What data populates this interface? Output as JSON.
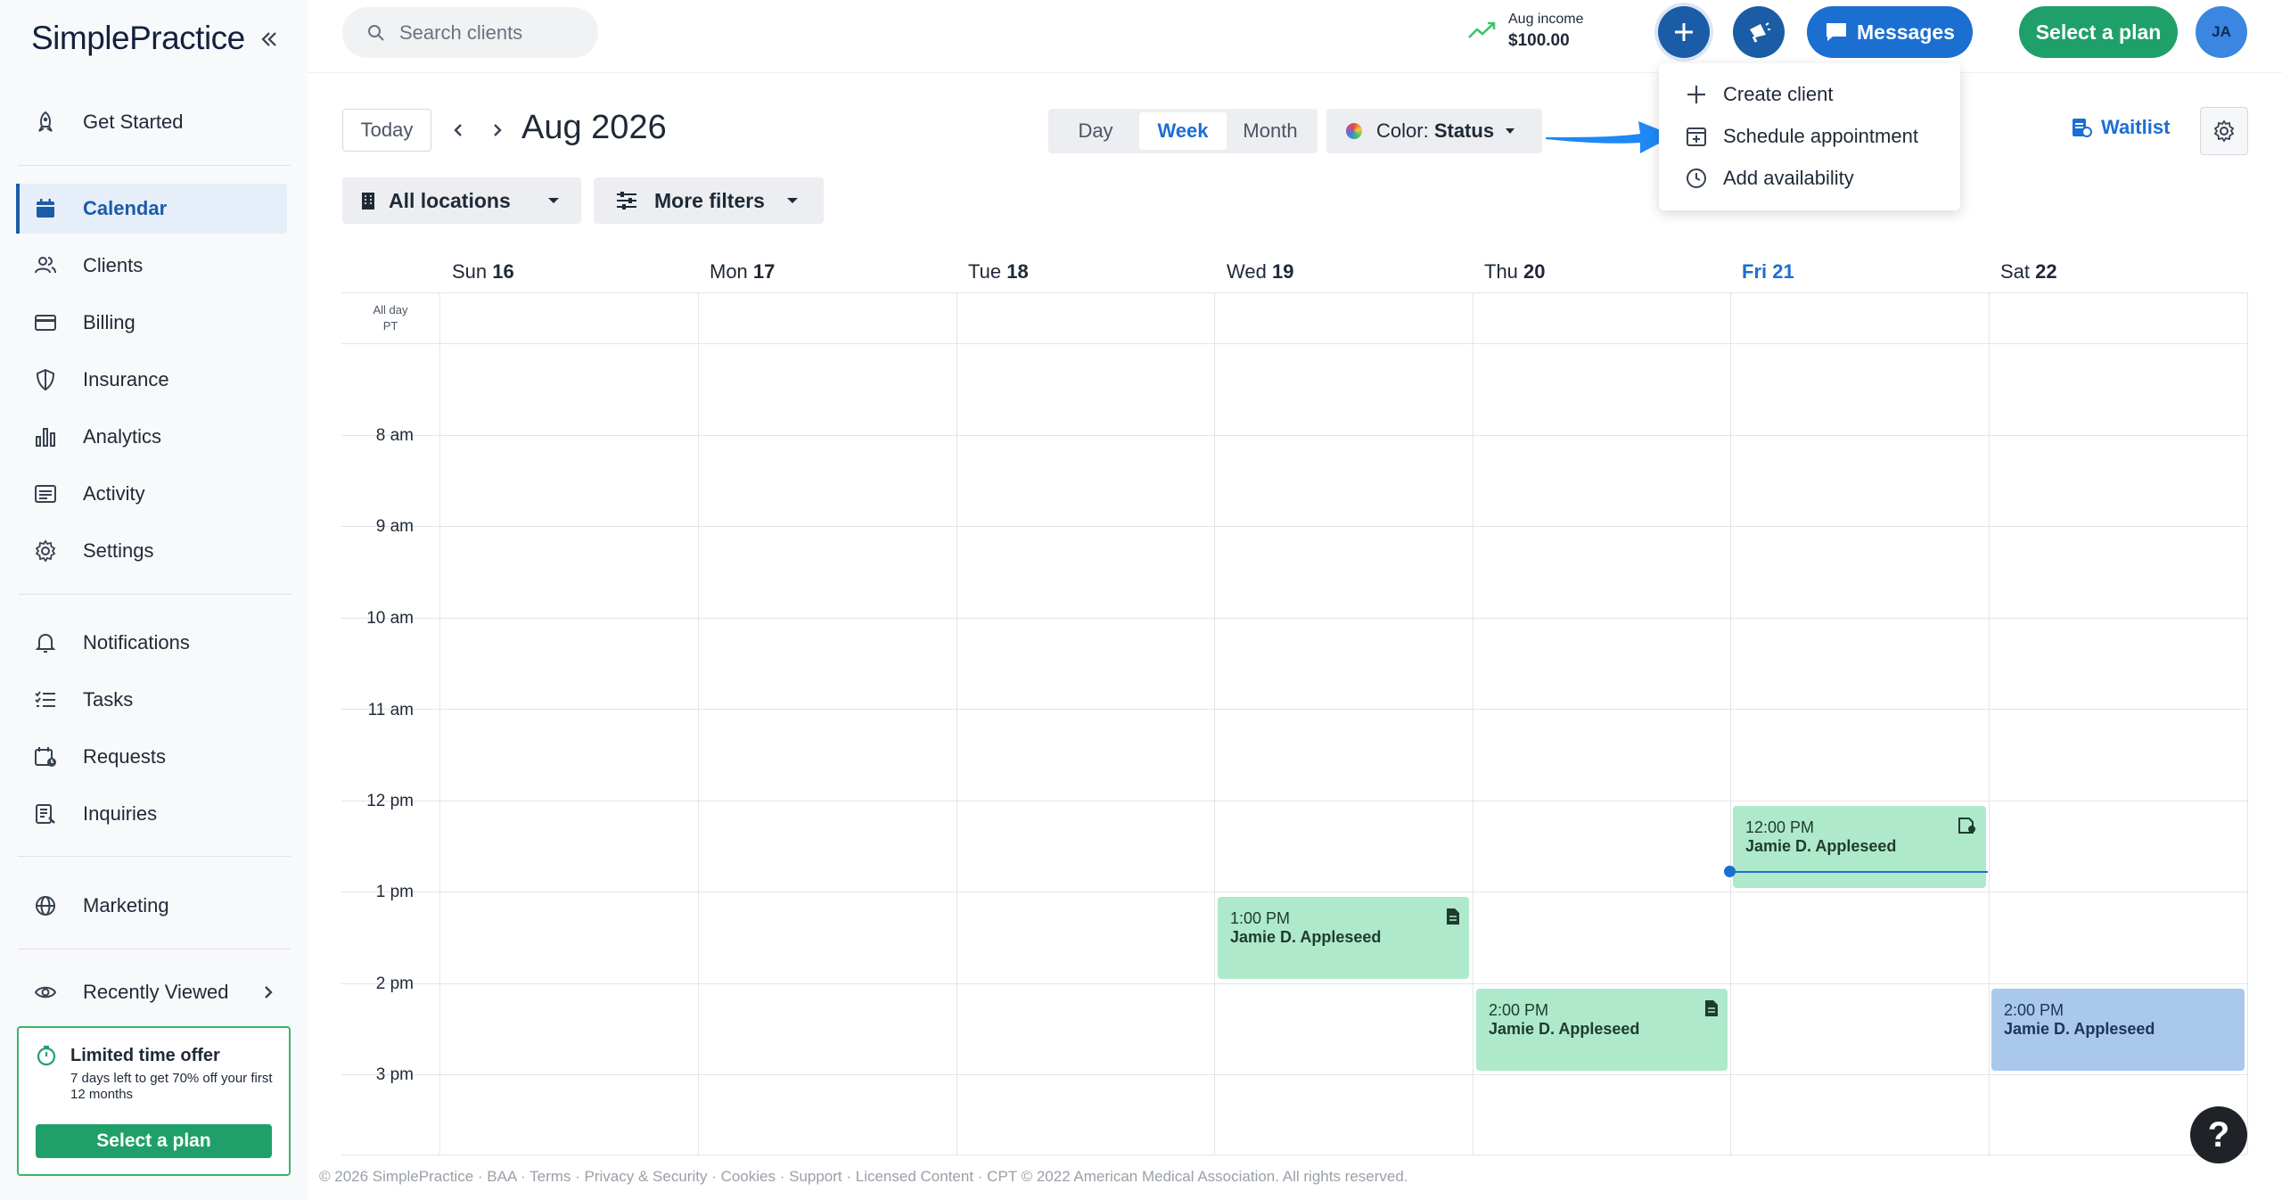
{
  "app": {
    "logo": "SimplePractice"
  },
  "sidebar": {
    "items": [
      {
        "label": "Get Started",
        "icon": "rocket-icon"
      },
      {
        "label": "Calendar",
        "icon": "calendar-icon",
        "active": true
      },
      {
        "label": "Clients",
        "icon": "clients-icon"
      },
      {
        "label": "Billing",
        "icon": "billing-icon"
      },
      {
        "label": "Insurance",
        "icon": "shield-icon"
      },
      {
        "label": "Analytics",
        "icon": "analytics-icon"
      },
      {
        "label": "Activity",
        "icon": "activity-icon"
      },
      {
        "label": "Settings",
        "icon": "gear-icon"
      },
      {
        "label": "Notifications",
        "icon": "bell-icon"
      },
      {
        "label": "Tasks",
        "icon": "tasks-icon"
      },
      {
        "label": "Requests",
        "icon": "requests-icon"
      },
      {
        "label": "Inquiries",
        "icon": "inquiries-icon"
      },
      {
        "label": "Marketing",
        "icon": "globe-icon"
      },
      {
        "label": "Recently Viewed",
        "icon": "eye-icon"
      }
    ],
    "offer": {
      "title": "Limited time offer",
      "text": "7 days left to get 70% off your first 12 months",
      "button": "Select a plan"
    }
  },
  "header": {
    "search_placeholder": "Search clients",
    "income_label": "Aug income",
    "income_value": "$100.00",
    "messages": "Messages",
    "select_plan": "Select a plan",
    "avatar_initials": "JA"
  },
  "dropdown": {
    "items": [
      {
        "label": "Create client",
        "icon": "plus-icon"
      },
      {
        "label": "Schedule appointment",
        "icon": "calendar-add-icon"
      },
      {
        "label": "Add availability",
        "icon": "clock-icon"
      }
    ]
  },
  "toolbar": {
    "today": "Today",
    "range_title": "Aug 2026",
    "views": [
      "Day",
      "Week",
      "Month"
    ],
    "active_view": "Week",
    "color_label": "Color:",
    "color_value": "Status",
    "waitlist": "Waitlist",
    "locations": "All locations",
    "more_filters": "More filters"
  },
  "calendar": {
    "days": [
      {
        "dow": "Sun",
        "date": "16"
      },
      {
        "dow": "Mon",
        "date": "17"
      },
      {
        "dow": "Tue",
        "date": "18"
      },
      {
        "dow": "Wed",
        "date": "19"
      },
      {
        "dow": "Thu",
        "date": "20"
      },
      {
        "dow": "Fri",
        "date": "21",
        "today": true
      },
      {
        "dow": "Sat",
        "date": "22"
      }
    ],
    "allday_label": "All day",
    "timezone": "PT",
    "times": [
      "8 am",
      "9 am",
      "10 am",
      "11 am",
      "12 pm",
      "1 pm",
      "2 pm",
      "3 pm"
    ],
    "events": [
      {
        "time": "12:00 PM",
        "name": "Jamie D. Appleseed",
        "day": "Fri",
        "color": "green",
        "icon": "video-note-icon"
      },
      {
        "time": "1:00 PM",
        "name": "Jamie D. Appleseed",
        "day": "Wed",
        "color": "green",
        "icon": "note-icon"
      },
      {
        "time": "2:00 PM",
        "name": "Jamie D. Appleseed",
        "day": "Thu",
        "color": "green",
        "icon": "note-icon"
      },
      {
        "time": "2:00 PM",
        "name": "Jamie D. Appleseed",
        "day": "Sat",
        "color": "blue"
      }
    ]
  },
  "footer": "© 2026 SimplePractice · BAA · Terms · Privacy & Security · Cookies · Support · Licensed Content · CPT © 2022 American Medical Association. All rights reserved.",
  "help_label": "?",
  "colors": {
    "primary": "#1b5ca6",
    "accent_blue": "#1b6fd1",
    "green": "#1fa06a",
    "event_green": "#aee9cb",
    "event_blue": "#a9c8ec"
  }
}
